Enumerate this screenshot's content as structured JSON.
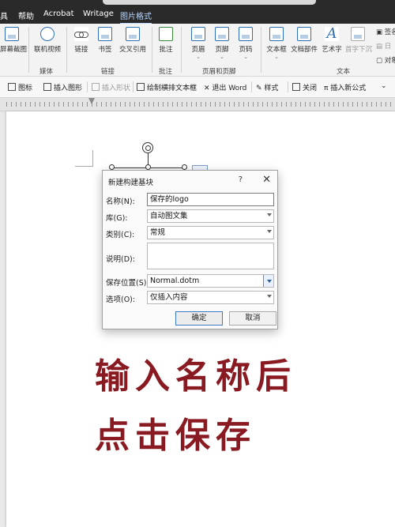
{
  "menubar": {
    "items": [
      "具",
      "帮助",
      "Acrobat",
      "Writage",
      "图片格式"
    ]
  },
  "ribbon": {
    "tools": {
      "screenshot": "屏幕截图",
      "online_video": "联机视频",
      "link": "链接",
      "bookmark": "书签",
      "cross_ref": "交叉引用",
      "comment": "批注",
      "header": "页眉",
      "footer": "页脚",
      "page_number": "页码",
      "textbox": "文本框",
      "doc_parts": "文档部件",
      "wordart": "艺术字",
      "dropcap": "首字下沉",
      "signature": "签名",
      "datetime": "日",
      "object": "对象"
    },
    "groups": {
      "media": "媒体",
      "links": "链接",
      "comments": "批注",
      "header_footer": "页眉和页脚",
      "text": "文本"
    }
  },
  "drawbar": {
    "items": [
      "图标",
      "插入图形",
      "插入形状",
      "绘制横排文本框",
      "退出 Word",
      "样式",
      "关闭",
      "插入新公式"
    ]
  },
  "dialog": {
    "title": "新建构建基块",
    "help": "?",
    "close": "✕",
    "fields": {
      "name": {
        "label": "名称(N):",
        "value": "保存的logo"
      },
      "gallery": {
        "label": "库(G):",
        "value": "自动图文集"
      },
      "category": {
        "label": "类别(C):",
        "value": "常规"
      },
      "description": {
        "label": "说明(D):",
        "value": ""
      },
      "save_in": {
        "label": "保存位置(S):",
        "value": "Normal.dotm"
      },
      "options": {
        "label": "选项(O):",
        "value": "仅插入内容"
      }
    },
    "ok": "确定",
    "cancel": "取消"
  },
  "caption": {
    "line1": "输入名称后",
    "line2": "点击保存"
  },
  "colors": {
    "caption": "#8a1a22",
    "accent": "#3c79c4",
    "menubar_bg": "#2a2a2a"
  }
}
